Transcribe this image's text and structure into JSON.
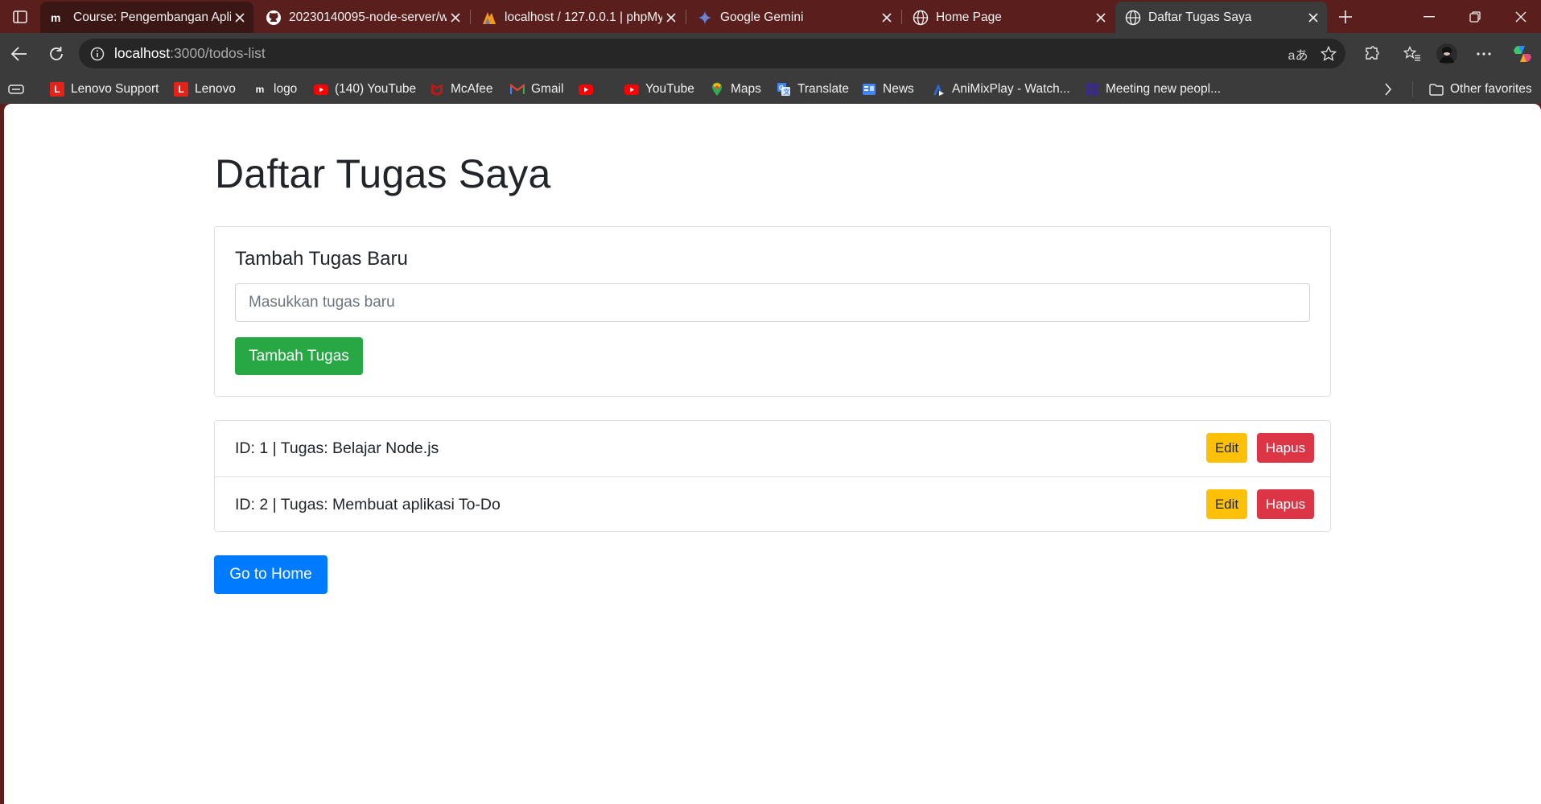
{
  "browser": {
    "tabs": [
      {
        "title": "Course: Pengembangan Aplik",
        "icon": "mahir-logo-icon"
      },
      {
        "title": "20230140095-node-server/w",
        "icon": "github-icon"
      },
      {
        "title": "localhost / 127.0.0.1 | phpMy",
        "icon": "phpmyadmin-icon"
      },
      {
        "title": "Google Gemini",
        "icon": "gemini-icon"
      },
      {
        "title": "Home Page",
        "icon": "globe-icon"
      },
      {
        "title": "Daftar Tugas Saya",
        "icon": "globe-icon",
        "active": true
      }
    ],
    "url_host": "localhost",
    "url_path": ":3000/todos-list",
    "bookmarks": [
      {
        "label": "Lenovo Support",
        "icon": "lenovo-icon",
        "color": "#e2231a"
      },
      {
        "label": "Lenovo",
        "icon": "lenovo-icon",
        "color": "#e2231a"
      },
      {
        "label": "logo",
        "icon": "mahir-logo-icon",
        "color": "#ffffff"
      },
      {
        "label": "(140) YouTube",
        "icon": "youtube-icon",
        "color": "#ff0000"
      },
      {
        "label": "McAfee",
        "icon": "mcafee-icon",
        "color": "#c01818"
      },
      {
        "label": "Gmail",
        "icon": "gmail-icon",
        "color": "#ea4335"
      },
      {
        "label": "",
        "icon": "youtube-icon",
        "color": "#ff0000"
      },
      {
        "label": "YouTube",
        "icon": "youtube-icon",
        "color": "#ff0000"
      },
      {
        "label": "Maps",
        "icon": "maps-icon",
        "color": "#34a853"
      },
      {
        "label": "Translate",
        "icon": "translate-icon",
        "color": "#4285f4"
      },
      {
        "label": "News",
        "icon": "news-icon",
        "color": "#4285f4"
      },
      {
        "label": "AniMixPlay - Watch...",
        "icon": "animixplay-icon",
        "color": "#2b6cd8"
      },
      {
        "label": "Meeting new peopl...",
        "icon": "meeting-icon",
        "color": "#3a2a8a"
      }
    ],
    "other_favorites": "Other favorites"
  },
  "page": {
    "title": "Daftar Tugas Saya",
    "form": {
      "heading": "Tambah Tugas Baru",
      "input_placeholder": "Masukkan tugas baru",
      "input_value": "",
      "submit_label": "Tambah Tugas"
    },
    "todos": [
      {
        "text": "ID: 1 | Tugas: Belajar Node.js",
        "edit_label": "Edit",
        "delete_label": "Hapus"
      },
      {
        "text": "ID: 2 | Tugas: Membuat aplikasi To-Do",
        "edit_label": "Edit",
        "delete_label": "Hapus"
      }
    ],
    "home_button": "Go to Home"
  },
  "colors": {
    "success": "#28a745",
    "warning": "#ffc107",
    "danger": "#dc3545",
    "primary": "#007bff",
    "tabstrip": "#5a1f1c"
  }
}
